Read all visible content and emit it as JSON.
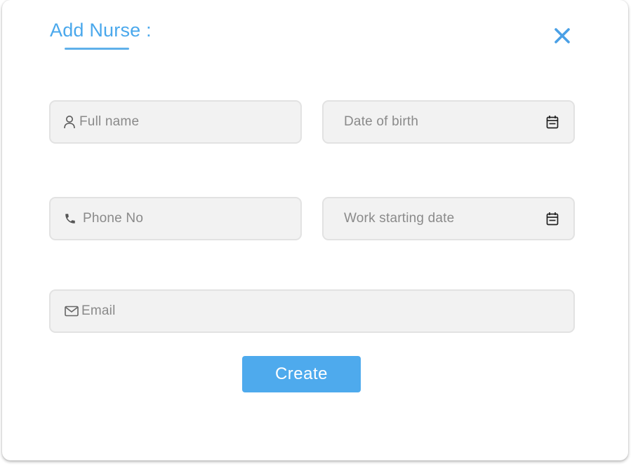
{
  "dialog": {
    "title": "Add Nurse :",
    "close_icon": "close-icon"
  },
  "form": {
    "full_name": {
      "placeholder": "Full name",
      "icon": "person-icon"
    },
    "date_of_birth": {
      "placeholder": "Date of birth",
      "icon": "calendar-icon"
    },
    "phone": {
      "placeholder": "Phone No",
      "icon": "phone-icon"
    },
    "work_starting_date": {
      "placeholder": "Work starting date",
      "icon": "calendar-icon"
    },
    "email": {
      "placeholder": "Email",
      "icon": "mail-icon"
    }
  },
  "actions": {
    "create_label": "Create"
  },
  "colors": {
    "accent": "#4eaaed",
    "field_bg": "#f2f2f2",
    "field_border": "#e2e2e2",
    "placeholder": "#8a8a8a"
  }
}
